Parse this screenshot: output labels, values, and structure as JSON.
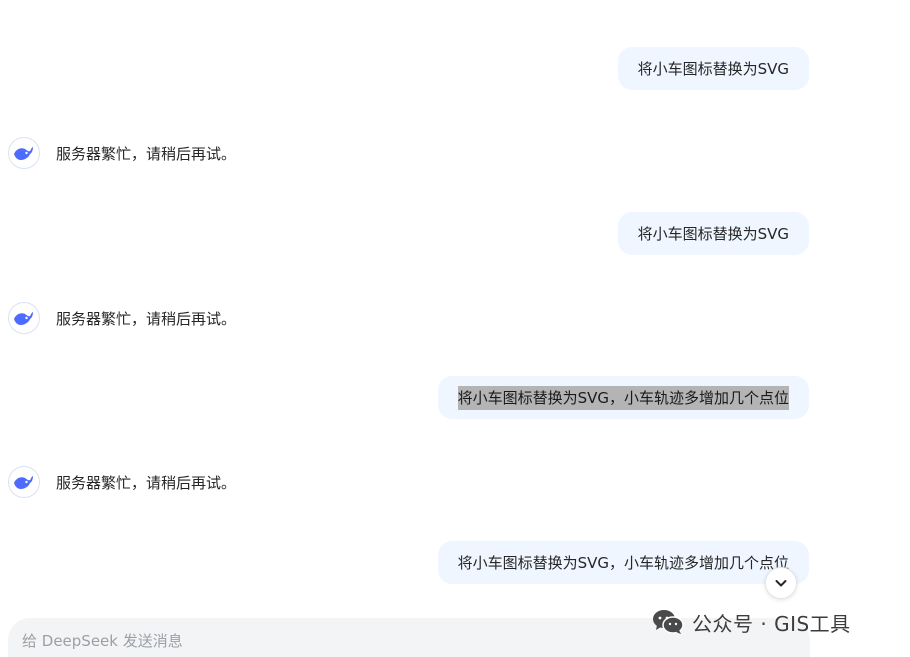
{
  "conversation": {
    "messages": [
      {
        "role": "user",
        "text": "将小车图标替换为SVG"
      },
      {
        "role": "assistant",
        "text": "服务器繁忙，请稍后再试。"
      },
      {
        "role": "user",
        "text": "将小车图标替换为SVG"
      },
      {
        "role": "assistant",
        "text": "服务器繁忙，请稍后再试。"
      },
      {
        "role": "user",
        "text": "将小车图标替换为SVG，小车轨迹多增加几个点位",
        "selected": true
      },
      {
        "role": "assistant",
        "text": "服务器繁忙，请稍后再试。"
      },
      {
        "role": "user",
        "text": "将小车图标替换为SVG，小车轨迹多增加几个点位"
      }
    ]
  },
  "composer": {
    "placeholder": "给 DeepSeek 发送消息"
  },
  "icons": {
    "assistant_avatar": "deepseek-whale-icon",
    "scroll_down": "chevron-down-icon",
    "watermark": "wechat-icon"
  },
  "watermark": {
    "text": "公众号 · GIS工具"
  },
  "colors": {
    "user_bubble_bg": "#eff6ff",
    "brand_blue": "#4d6bfe",
    "selection_bg": "#b4b4b4",
    "composer_bg": "#f3f4f6"
  }
}
